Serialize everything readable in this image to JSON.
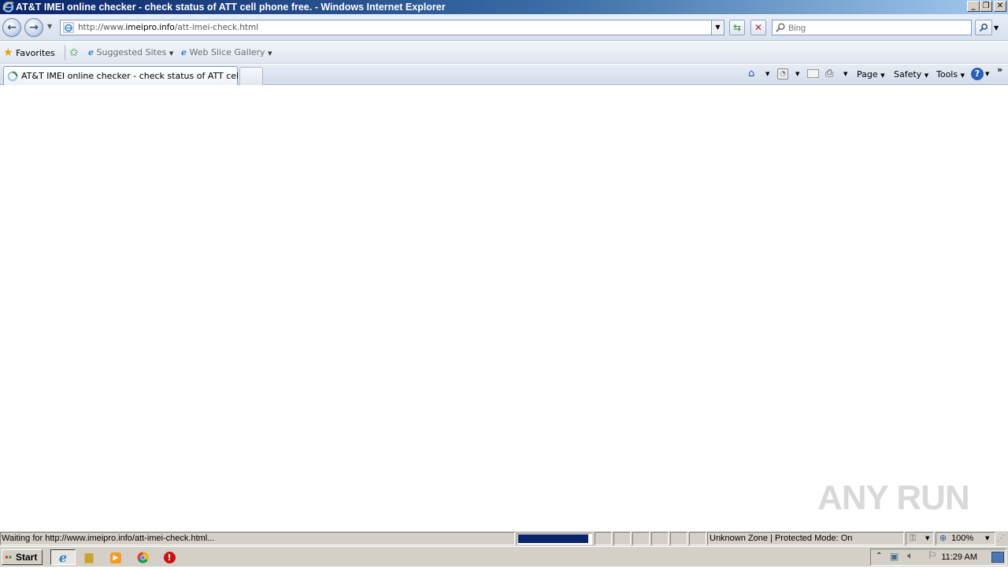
{
  "window": {
    "title": "AT&T IMEI online checker - check status of ATT cell phone free. - Windows Internet Explorer"
  },
  "address_bar": {
    "url_prefix": "http://www.",
    "url_domain": "imeipro.info",
    "url_path": "/att-imei-check.html"
  },
  "search": {
    "placeholder": "Bing"
  },
  "favorites_bar": {
    "favorites_label": "Favorites",
    "items": [
      {
        "label": "Suggested Sites"
      },
      {
        "label": "Web Slice Gallery"
      }
    ]
  },
  "tabs": [
    {
      "label": "AT&T IMEI online checker - check status of ATT cell p..."
    }
  ],
  "command_bar": {
    "page_label": "Page",
    "safety_label": "Safety",
    "tools_label": "Tools"
  },
  "status_bar": {
    "text": "Waiting for http://www.imeipro.info/att-imei-check.html...",
    "zone": "Unknown Zone | Protected Mode: On",
    "zoom": "100%",
    "progress_fraction": 0.97
  },
  "taskbar": {
    "start_label": "Start",
    "clock": "11:29 AM"
  },
  "watermark": {
    "text": "ANY RUN"
  },
  "colors": {
    "titlebar_start": "#0a246a",
    "progress_fill": "#0a246a",
    "chrome_grey": "#d4d0c8"
  }
}
